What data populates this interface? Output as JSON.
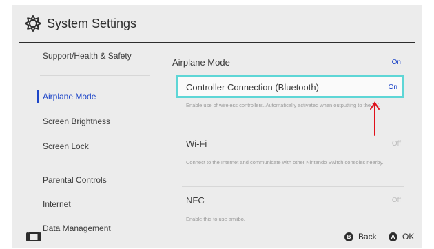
{
  "header": {
    "title": "System Settings",
    "icon": "gear-icon"
  },
  "sidebar": {
    "items": [
      {
        "label": "Support/Health & Safety"
      },
      {
        "label": "Airplane Mode"
      },
      {
        "label": "Screen Brightness"
      },
      {
        "label": "Screen Lock"
      },
      {
        "label": "Parental Controls"
      },
      {
        "label": "Internet"
      },
      {
        "label": "Data Management"
      }
    ],
    "selected": "Airplane Mode"
  },
  "content": {
    "airplane_mode": {
      "title": "Airplane Mode",
      "status": "On"
    },
    "controller": {
      "title": "Controller Connection (Bluetooth)",
      "status": "On",
      "description": "Enable use of wireless controllers. Automatically activated when outputting to the TV."
    },
    "wifi": {
      "title": "Wi-Fi",
      "status": "Off",
      "description": "Connect to the Internet and communicate with other Nintendo Switch consoles nearby."
    },
    "nfc": {
      "title": "NFC",
      "status": "Off",
      "description": "Enable this to use amiibo."
    }
  },
  "footer": {
    "back": {
      "glyph": "B",
      "label": "Back"
    },
    "ok": {
      "glyph": "A",
      "label": "OK"
    }
  },
  "annotation": {
    "color": "#e0101a"
  },
  "colors": {
    "accent": "#1e46c8",
    "highlight": "#5ed6d6",
    "background": "#ececec"
  }
}
